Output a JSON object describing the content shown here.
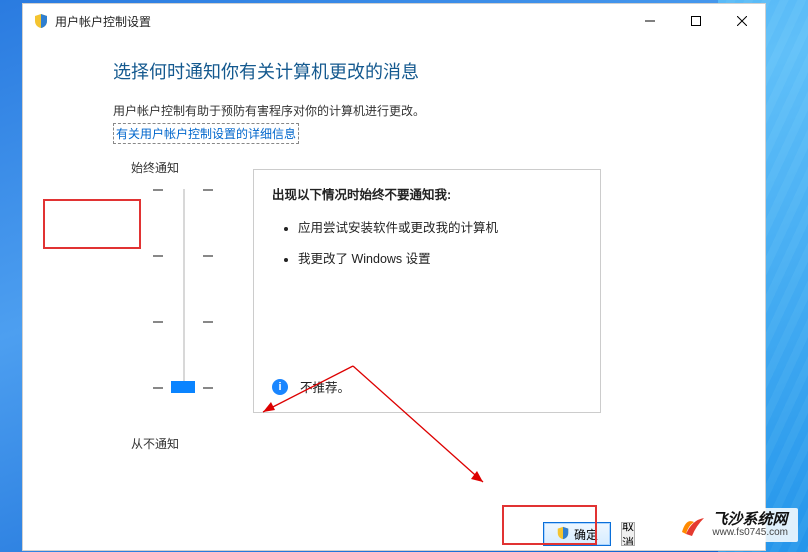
{
  "window": {
    "title": "用户帐户控制设置"
  },
  "page": {
    "heading": "选择何时通知你有关计算机更改的消息",
    "description": "用户帐户控制有助于预防有害程序对你的计算机进行更改。",
    "link": "有关用户帐户控制设置的详细信息"
  },
  "slider": {
    "top_label": "始终通知",
    "bottom_label": "从不通知",
    "level": 0
  },
  "panel": {
    "heading": "出现以下情况时始终不要通知我:",
    "bullets": [
      "应用尝试安装软件或更改我的计算机",
      "我更改了 Windows 设置"
    ],
    "recommendation": "不推荐。"
  },
  "buttons": {
    "ok": "确定",
    "cancel": "取消"
  },
  "watermark": {
    "name": "飞沙系统网",
    "url": "www.fs0745.com"
  }
}
